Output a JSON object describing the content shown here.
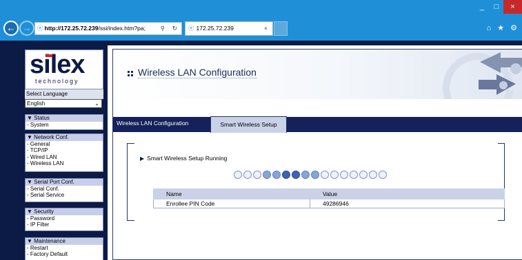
{
  "browser": {
    "url_host": "http://172.25.72.239",
    "url_rest": "/ssi/index.htm?pa;",
    "tab_title": "172.25.72.239",
    "tab_close": "×",
    "win_min": "_",
    "win_max": "□",
    "win_close": "×"
  },
  "sidebar": {
    "logo_brand": "silex",
    "logo_sub": "technology",
    "select_language_label": "Select Language",
    "language_value": "English",
    "sections": [
      {
        "header": "▼ Status",
        "items": [
          "- System"
        ]
      },
      {
        "header": "▼ Network Conf.",
        "items": [
          "- General",
          "- TCP/IP",
          "- Wired LAN",
          "- Wireless LAN"
        ]
      },
      {
        "header": "▼ Serial Port Conf.",
        "items": [
          "- Serial Conf.",
          "- Serial Service"
        ]
      },
      {
        "header": "▼ Security",
        "items": [
          "- Password",
          "- IP Filter"
        ]
      },
      {
        "header": "▼ Maintenance",
        "items": [
          "- Restart",
          "- Factory Default"
        ]
      }
    ]
  },
  "main": {
    "title": "Wireless LAN Configuration",
    "tabs": [
      "Wireless LAN Configuration",
      "Smart Wireless Setup"
    ],
    "status_text": "Smart Wireless Setup Running",
    "progress_dots": [
      "light",
      "light",
      "light",
      "mid",
      "mid",
      "dark",
      "dark",
      "mid",
      "mid",
      "light",
      "light",
      "light",
      "light",
      "light",
      "light",
      "light"
    ],
    "table": {
      "headers": [
        "Name",
        "Value"
      ],
      "rows": [
        [
          "Enrollee PIN Code",
          "49286946"
        ]
      ]
    }
  }
}
